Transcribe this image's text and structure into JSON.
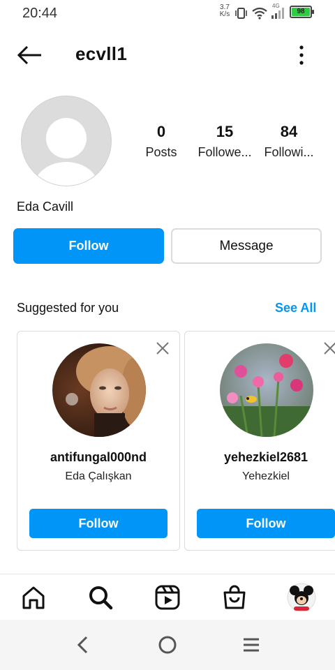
{
  "status": {
    "time": "20:44",
    "speed_value": "3.7",
    "speed_unit": "K/s",
    "network": "4G",
    "battery": "98"
  },
  "header": {
    "username": "ecvll1"
  },
  "profile": {
    "full_name": "Eda Cavill",
    "stats": [
      {
        "value": "0",
        "label": "Posts"
      },
      {
        "value": "15",
        "label": "Followe..."
      },
      {
        "value": "84",
        "label": "Followi..."
      }
    ]
  },
  "actions": {
    "follow_label": "Follow",
    "message_label": "Message"
  },
  "suggested": {
    "title": "Suggested for you",
    "see_all": "See All",
    "cards": [
      {
        "username": "antifungal000nd",
        "name": "Eda Çalışkan",
        "follow_label": "Follow"
      },
      {
        "username": "yehezkiel2681",
        "name": "Yehezkiel",
        "follow_label": "Follow"
      }
    ]
  },
  "colors": {
    "accent": "#0095f6",
    "border": "#dbdbdb"
  },
  "nav": [
    "home-icon",
    "search-icon",
    "reels-icon",
    "shop-icon",
    "profile-avatar"
  ]
}
